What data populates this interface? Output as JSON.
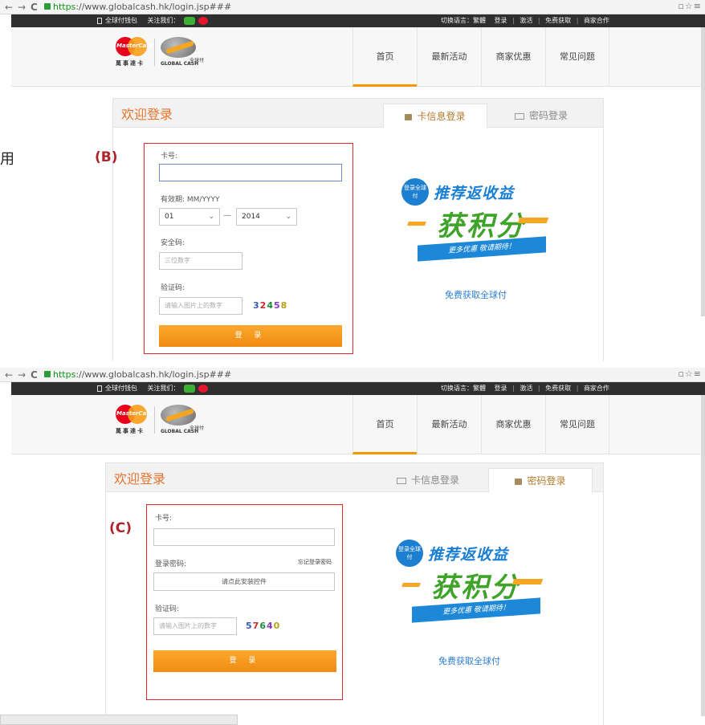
{
  "browser": {
    "back": "←",
    "forward": "→",
    "reload": "C",
    "url_https": "https",
    "url_rest": "://www.globalcash.hk/login.jsp###"
  },
  "topstrip": {
    "wallet": "全球付钱包",
    "follow": "关注我们：",
    "lang": "切换语言：繁體",
    "login": "登录",
    "activate": "激活",
    "free_get": "免费获取",
    "merchant": "商家合作",
    "sep": "|"
  },
  "header": {
    "mc_name": "MasterCard",
    "mc_cn": "萬事達卡",
    "gc_cn": "全球付",
    "gc_en": "GLOBAL CASH",
    "nav": [
      "首页",
      "最新活动",
      "商家优惠",
      "常见问题"
    ]
  },
  "login": {
    "welcome": "欢迎登录",
    "tab_card": "卡信息登录",
    "tab_password": "密码登录"
  },
  "form_b": {
    "tag": "(B)",
    "card_label": "卡号:",
    "card_value": "",
    "expiry_label": "有效期: MM/YYYY",
    "month": "01",
    "year": "2014",
    "dash": "—",
    "cvv_label": "安全码:",
    "cvv_placeholder": "三位数字",
    "captcha_label": "验证码:",
    "captcha_placeholder": "请输入图片上的数字",
    "captcha": [
      "3",
      "2",
      "4",
      "5",
      "8"
    ],
    "submit": "登 录"
  },
  "form_c": {
    "tag": "(C)",
    "card_label": "卡号:",
    "card_value": "",
    "pwd_label": "登录密码:",
    "forgot": "忘记登录密码",
    "pwd_placeholder": "请点此安装控件",
    "captcha_label": "验证码:",
    "captcha_placeholder": "请输入图片上的数字",
    "captcha": [
      "5",
      "7",
      "6",
      "4",
      "0"
    ],
    "submit": "登 录"
  },
  "promo": {
    "badge": "登录全球付",
    "line1": "推荐返收益",
    "line2": "获积分",
    "ribbon": "更多优惠 敬请期待！",
    "link": "免费获取全球付"
  },
  "partial_char": "用",
  "icons": [
    "back-icon",
    "forward-icon",
    "reload-icon",
    "lock-icon",
    "wechat-icon",
    "weibo-icon",
    "card-icon",
    "padlock-icon",
    "chevron-down-icon"
  ],
  "colors": {
    "accent": "#f39800",
    "welcome": "#e8742c",
    "link": "#2c7ed0",
    "highlight_border": "#e02a2a"
  }
}
